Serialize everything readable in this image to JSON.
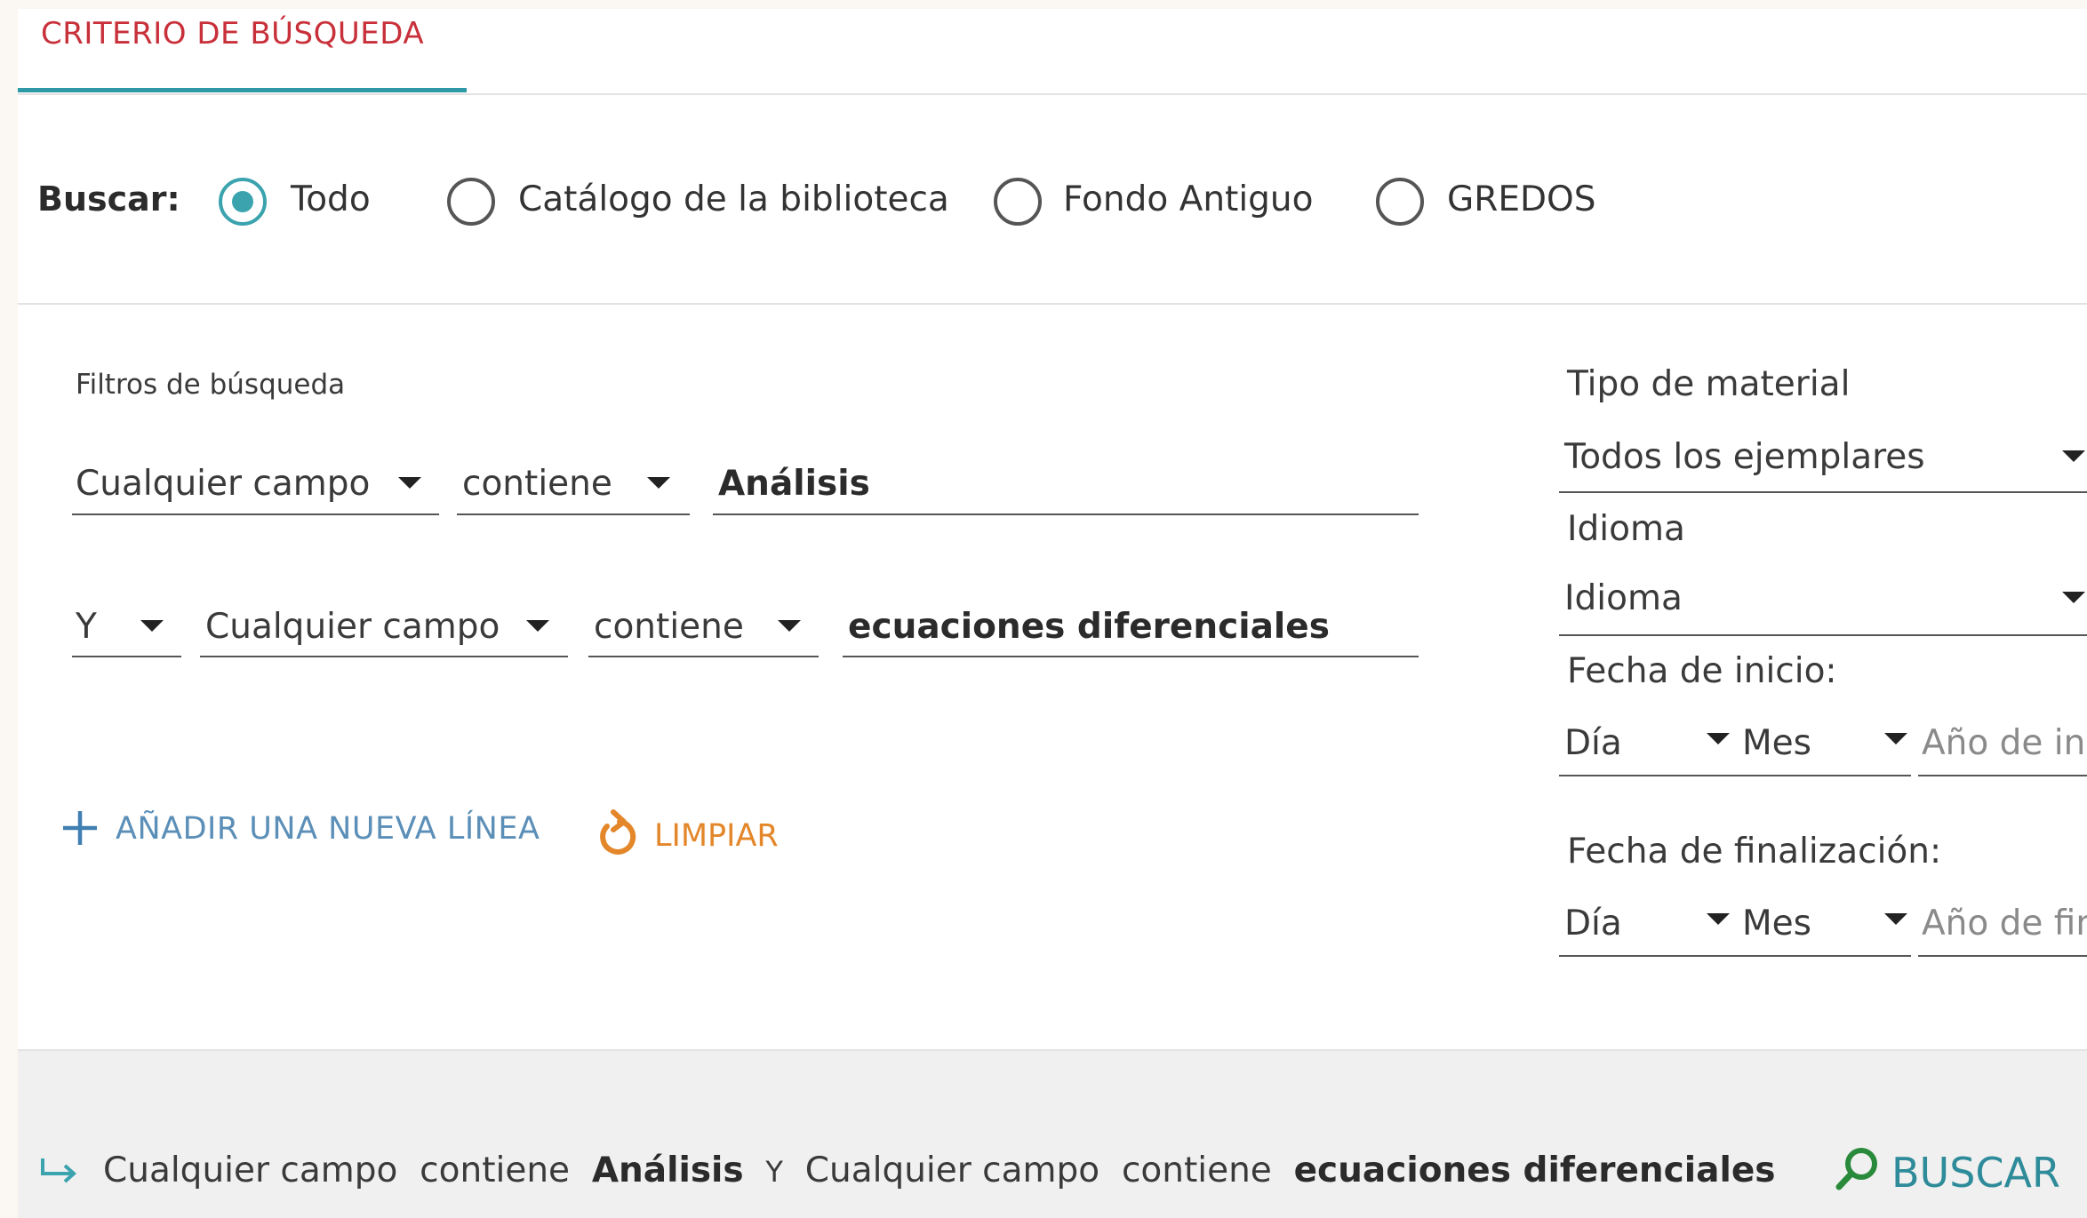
{
  "tab": {
    "label": "CRITERIO DE BÚSQUEDA"
  },
  "scope": {
    "label": "Buscar:",
    "options": [
      {
        "label": "Todo",
        "selected": true
      },
      {
        "label": "Catálogo de la biblioteca",
        "selected": false
      },
      {
        "label": "Fondo Antiguo",
        "selected": false
      },
      {
        "label": "GREDOS",
        "selected": false
      }
    ]
  },
  "filters": {
    "title": "Filtros de búsqueda",
    "lines": [
      {
        "field": "Cualquier campo",
        "operator": "contiene",
        "value": "Análisis"
      },
      {
        "boolean": "Y",
        "field": "Cualquier campo",
        "operator": "contiene",
        "value": "ecuaciones diferenciales"
      }
    ],
    "add_line_label": "AÑADIR UNA NUEVA LÍNEA",
    "clear_label": "LIMPIAR"
  },
  "side": {
    "material_label": "Tipo de material",
    "material_value": "Todos los ejemplares",
    "language_label": "Idioma",
    "language_value": "Idioma",
    "start_label": "Fecha de inicio:",
    "start": {
      "day": "Día",
      "month": "Mes",
      "year_placeholder": "Año de ini"
    },
    "end_label": "Fecha de finalización:",
    "end": {
      "day": "Día",
      "month": "Mes",
      "year_placeholder": "Año de fin"
    }
  },
  "summary": {
    "field1": "Cualquier campo",
    "op1": "contiene",
    "value1": "Análisis",
    "boolean": "Y",
    "field2": "Cualquier campo",
    "op2": "contiene",
    "value2": "ecuaciones diferenciales"
  },
  "search_button": {
    "label": "BUSCAR"
  },
  "colors": {
    "accent": "#3aa3ae",
    "tab_text": "#c8303a",
    "link_blue": "#5b8fb8",
    "clear_orange": "#e3872a",
    "search_teal": "#2e8b99"
  }
}
